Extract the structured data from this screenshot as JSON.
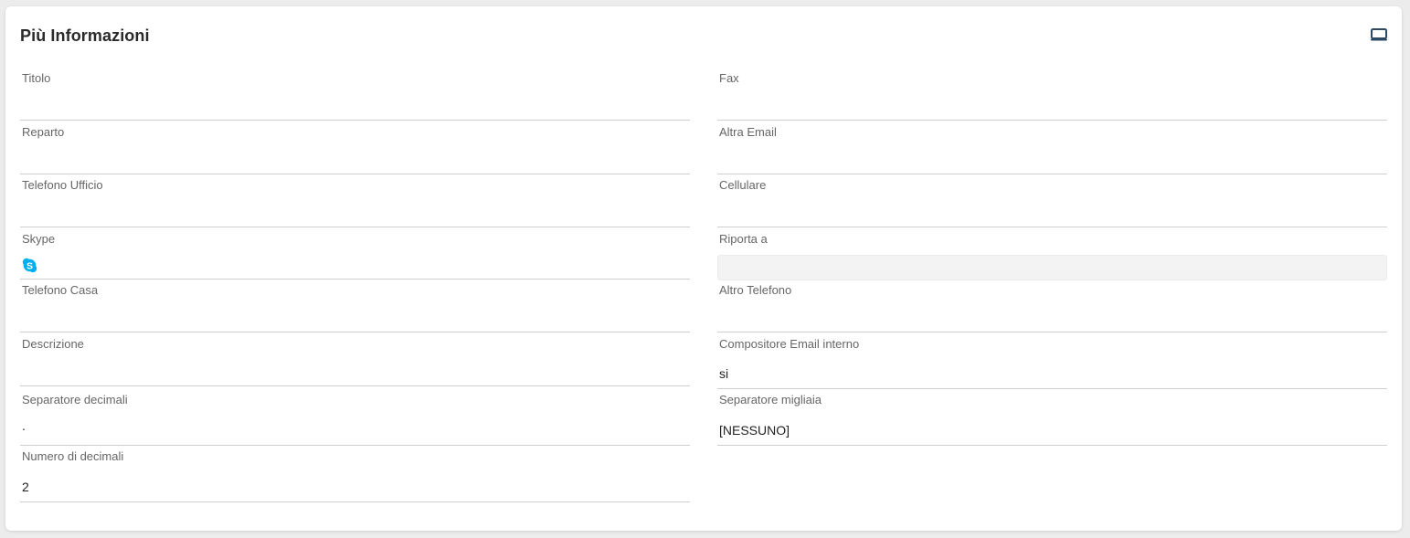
{
  "panel": {
    "title": "Più Informazioni",
    "toggle_icon": "monitor-icon"
  },
  "fields_left": [
    {
      "key": "titolo",
      "label": "Titolo",
      "value": ""
    },
    {
      "key": "reparto",
      "label": "Reparto",
      "value": ""
    },
    {
      "key": "telefono-ufficio",
      "label": "Telefono Ufficio",
      "value": ""
    },
    {
      "key": "skype",
      "label": "Skype",
      "value": "",
      "icon": "skype-icon"
    },
    {
      "key": "telefono-casa",
      "label": "Telefono Casa",
      "value": ""
    },
    {
      "key": "descrizione",
      "label": "Descrizione",
      "value": ""
    },
    {
      "key": "separatore-decimali",
      "label": "Separatore decimali",
      "value": "."
    },
    {
      "key": "numero-decimali",
      "label": "Numero di decimali",
      "value": "2"
    }
  ],
  "fields_right": [
    {
      "key": "fax",
      "label": "Fax",
      "value": ""
    },
    {
      "key": "altra-email",
      "label": "Altra Email",
      "value": ""
    },
    {
      "key": "cellulare",
      "label": "Cellulare",
      "value": ""
    },
    {
      "key": "riporta-a",
      "label": "Riporta a",
      "value": "",
      "disabled": true
    },
    {
      "key": "altro-telefono",
      "label": "Altro Telefono",
      "value": ""
    },
    {
      "key": "compositore-email",
      "label": "Compositore Email interno",
      "value": "si"
    },
    {
      "key": "separatore-migliaia",
      "label": "Separatore migliaia",
      "value": "[NESSUNO]"
    }
  ],
  "colors": {
    "skype": "#00aff0",
    "monitor_icon": "#2c4a63"
  }
}
